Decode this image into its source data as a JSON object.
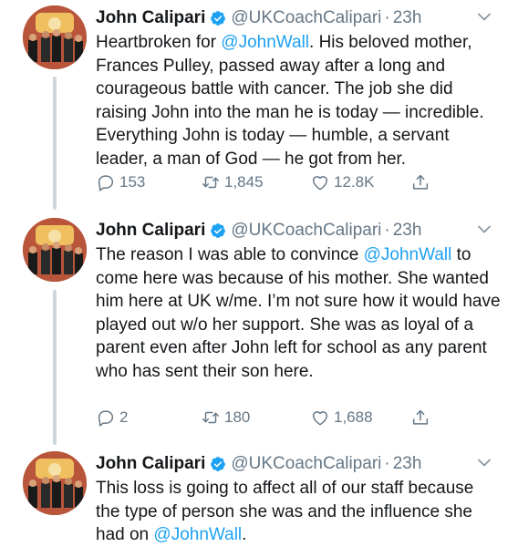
{
  "tweets": [
    {
      "author": "John Calipari",
      "handle": "@UKCoachCalipari",
      "time": "23h",
      "text_before": "Heartbroken for ",
      "mention": "@JohnWall",
      "text_after": ". His beloved mother, Frances Pulley, passed away after a long and courageous battle with cancer. The job she did raising John into the man he is today — incredible. Everything John is today — humble, a servant leader, a man of God — he got from her.",
      "replies": "153",
      "retweets": "1,845",
      "likes": "12.8K"
    },
    {
      "author": "John Calipari",
      "handle": "@UKCoachCalipari",
      "time": "23h",
      "text_before": "The reason I was able to convince ",
      "mention": "@JohnWall",
      "text_after": " to come here was because of his mother. She wanted him here at UK w/me. I’m not sure how it would have played out w/o her support. She was as loyal of a parent even after John left for school as any parent who has sent their son here.",
      "replies": "2",
      "retweets": "180",
      "likes": "1,688"
    },
    {
      "author": "John Calipari",
      "handle": "@UKCoachCalipari",
      "time": "23h",
      "text_before": "This loss is going to affect all of our staff because the type of person she was and the influence she had on ",
      "mention": "@JohnWall",
      "text_after": "."
    }
  ],
  "separator": "·",
  "colors": {
    "mention": "#1da1f2",
    "verified": "#1da1f2",
    "secondary_text": "#657786",
    "thread_line": "#ccd6dd"
  },
  "icons": {
    "verified": "verified-badge-icon",
    "caret": "chevron-down-icon",
    "reply": "reply-icon",
    "retweet": "retweet-icon",
    "like": "heart-icon",
    "share": "share-icon"
  }
}
